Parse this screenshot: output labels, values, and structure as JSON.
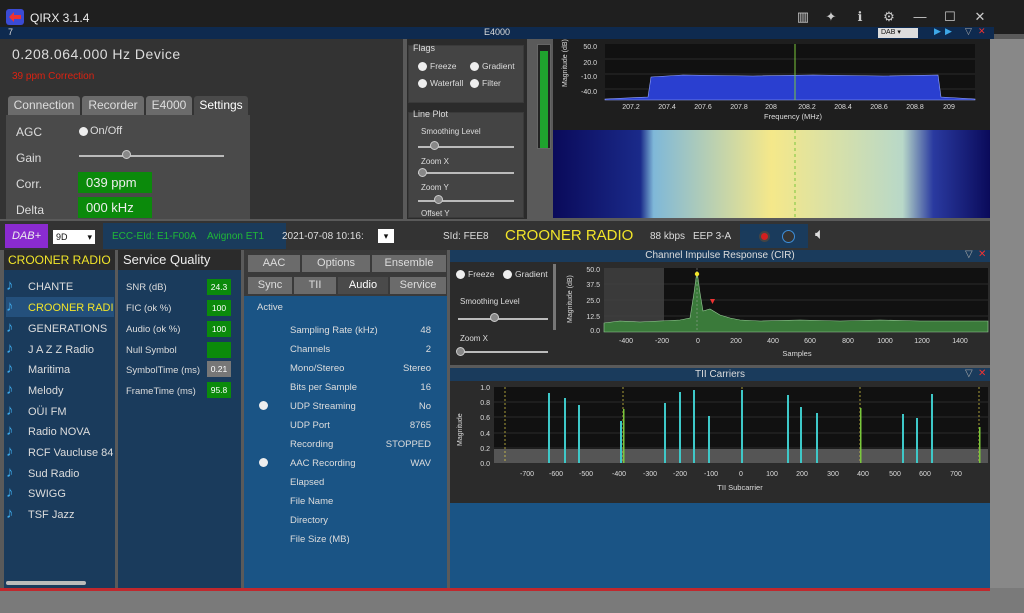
{
  "window": {
    "title": "QIRX 3.1.4"
  },
  "device_bar": {
    "left": "7",
    "center": "E4000",
    "mode": "DAB"
  },
  "device": {
    "frequency": "0.208.064.000 Hz Device",
    "ppm_correction": "39 ppm Correction"
  },
  "tabs": [
    "Connection",
    "Recorder",
    "E4000",
    "Settings"
  ],
  "settings": {
    "agc_label": "AGC",
    "agc_value": "On/Off",
    "gain_label": "Gain",
    "corr_label": "Corr.",
    "corr_value": "039 ppm",
    "delta_label": "Delta",
    "delta_value": "000 kHz"
  },
  "flags": {
    "title": "Flags",
    "freeze": "Freeze",
    "gradient": "Gradient",
    "waterfall": "Waterfall",
    "filter": "Filter"
  },
  "line_plot": {
    "title": "Line Plot",
    "smoothing": "Smoothing Level",
    "zoom_x": "Zoom X",
    "zoom_y": "Zoom Y",
    "offset_y": "Offset Y"
  },
  "spectrum": {
    "ylabel": "Magnitude (dB)",
    "xlabel": "Frequency (MHz)",
    "yticks": [
      "50.0",
      "20.0",
      "-10.0",
      "-40.0"
    ],
    "xticks": [
      "207.2",
      "207.4",
      "207.6",
      "207.8",
      "208",
      "208.2",
      "208.4",
      "208.6",
      "208.8",
      "209"
    ]
  },
  "dab_bar": {
    "dab_label": "DAB+",
    "channel": "9D",
    "ecc": "ECC-EId: E1-F00A",
    "ensemble": "Avignon ET1",
    "datetime": "2021-07-08  10:16:",
    "sid": "SId: FEE8",
    "station": "CROONER RADIO",
    "bitrate": "88 kbps",
    "eep": "EEP 3-A"
  },
  "service_list": {
    "title": "CROONER RADIO",
    "items": [
      "CHANTE FRANC",
      "CROONER RADI",
      "GENERATIONS",
      "J A Z Z Radio",
      "Maritima",
      "Melody",
      "OÜI FM",
      "Radio NOVA",
      "RCF Vaucluse 84",
      "Sud Radio",
      "SWIGG",
      "TSF Jazz"
    ]
  },
  "quality": {
    "title": "Service Quality",
    "rows": [
      {
        "label": "SNR (dB)",
        "value": "24.3"
      },
      {
        "label": "FIC (ok %)",
        "value": "100"
      },
      {
        "label": "Audio (ok %)",
        "value": "100"
      },
      {
        "label": "Null Symbol",
        "value": ""
      },
      {
        "label": "SymbolTime (ms)",
        "value": "0.21"
      },
      {
        "label": "FrameTime (ms)",
        "value": "95.8"
      }
    ]
  },
  "audio_tabs": {
    "row1": [
      "AAC",
      "Options",
      "Ensemble"
    ],
    "row2": [
      "Sync",
      "TII",
      "Audio",
      "Service"
    ],
    "active_label": "Active"
  },
  "audio": [
    {
      "label": "Sampling Rate (kHz)",
      "value": "48"
    },
    {
      "label": "Channels",
      "value": "2"
    },
    {
      "label": "Mono/Stereo",
      "value": "Stereo"
    },
    {
      "label": "Bits per Sample",
      "value": "16"
    },
    {
      "label": "UDP Streaming",
      "value": "No"
    },
    {
      "label": "UDP Port",
      "value": "8765"
    },
    {
      "label": "Recording",
      "value": "STOPPED"
    },
    {
      "label": "AAC Recording",
      "value": "WAV"
    },
    {
      "label": "Elapsed",
      "value": ""
    },
    {
      "label": "File Name",
      "value": ""
    },
    {
      "label": "Directory",
      "value": ""
    },
    {
      "label": "File Size (MB)",
      "value": ""
    }
  ],
  "cir": {
    "title": "Channel Impulse Response (CIR)",
    "freeze": "Freeze",
    "gradient": "Gradient",
    "smoothing": "Smoothing Level",
    "zoom_x": "Zoom X",
    "ylabel": "Magnitude (dB)",
    "xlabel": "Samples",
    "yticks": [
      "50.0",
      "37.5",
      "25.0",
      "12.5",
      "0.0"
    ],
    "xticks": [
      "-400",
      "-200",
      "0",
      "200",
      "400",
      "600",
      "800",
      "1000",
      "1200",
      "1400"
    ]
  },
  "tii": {
    "title": "TII Carriers",
    "ylabel": "Magnitude",
    "xlabel": "TII Subcarrier",
    "yticks": [
      "1.0",
      "0.8",
      "0.6",
      "0.4",
      "0.2",
      "0.0"
    ],
    "xticks": [
      "-700",
      "-600",
      "-500",
      "-400",
      "-300",
      "-200",
      "-100",
      "0",
      "100",
      "200",
      "300",
      "400",
      "500",
      "600",
      "700"
    ]
  },
  "colors": {
    "accent_blue": "#1a5485",
    "green": "#0b8a0b",
    "red": "#d21f1f",
    "yellow": "#f2e529"
  }
}
